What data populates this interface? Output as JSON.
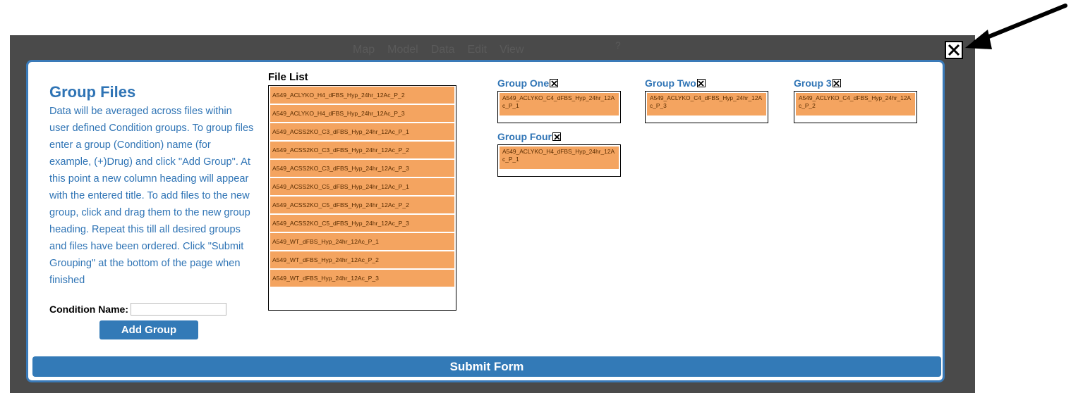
{
  "background_menu": {
    "items": [
      "Map",
      "Model",
      "Data",
      "Edit",
      "View"
    ],
    "help": "?"
  },
  "instructions": {
    "title": "Group Files",
    "description": "Data will be averaged across files within user defined Condition groups. To group files enter a group (Condition) name (for example, (+)Drug) and click \"Add Group\". At this point a new column heading will appear with the entered title. To add files to the new group, click and drag them to the new group heading. Repeat this till all desired groups and files have been ordered. Click \"Submit Grouping\" at the bottom of the page when finished"
  },
  "condition": {
    "label": "Condition Name:",
    "value": "",
    "add_button": "Add Group"
  },
  "file_list": {
    "title": "File List",
    "files": [
      "A549_ACLYKO_H4_dFBS_Hyp_24hr_12Ac_P_2",
      "A549_ACLYKO_H4_dFBS_Hyp_24hr_12Ac_P_3",
      "A549_ACSS2KO_C3_dFBS_Hyp_24hr_12Ac_P_1",
      "A549_ACSS2KO_C3_dFBS_Hyp_24hr_12Ac_P_2",
      "A549_ACSS2KO_C3_dFBS_Hyp_24hr_12Ac_P_3",
      "A549_ACSS2KO_C5_dFBS_Hyp_24hr_12Ac_P_1",
      "A549_ACSS2KO_C5_dFBS_Hyp_24hr_12Ac_P_2",
      "A549_ACSS2KO_C5_dFBS_Hyp_24hr_12Ac_P_3",
      "A549_WT_dFBS_Hyp_24hr_12Ac_P_1",
      "A549_WT_dFBS_Hyp_24hr_12Ac_P_2",
      "A549_WT_dFBS_Hyp_24hr_12Ac_P_3"
    ]
  },
  "groups": [
    {
      "name": "Group One",
      "files": [
        "A549_ACLYKO_C4_dFBS_Hyp_24hr_12Ac_P_1"
      ]
    },
    {
      "name": "Group Two",
      "files": [
        "A549_ACLYKO_C4_dFBS_Hyp_24hr_12Ac_P_3"
      ]
    },
    {
      "name": "Group 3",
      "files": [
        "A549_ACLYKO_C4_dFBS_Hyp_24hr_12Ac_P_2"
      ]
    },
    {
      "name": "Group Four",
      "files": [
        "A549_ACLYKO_H4_dFBS_Hyp_24hr_12Ac_P_1"
      ]
    }
  ],
  "submit_label": "Submit Form",
  "icons": {
    "close": "close-icon",
    "group_remove": "close-icon",
    "annotation": "arrow-icon"
  },
  "colors": {
    "accent": "#337ab7",
    "heading": "#2f74b5",
    "file_bg": "#f4a460",
    "overlay": "#4a4a4a"
  }
}
